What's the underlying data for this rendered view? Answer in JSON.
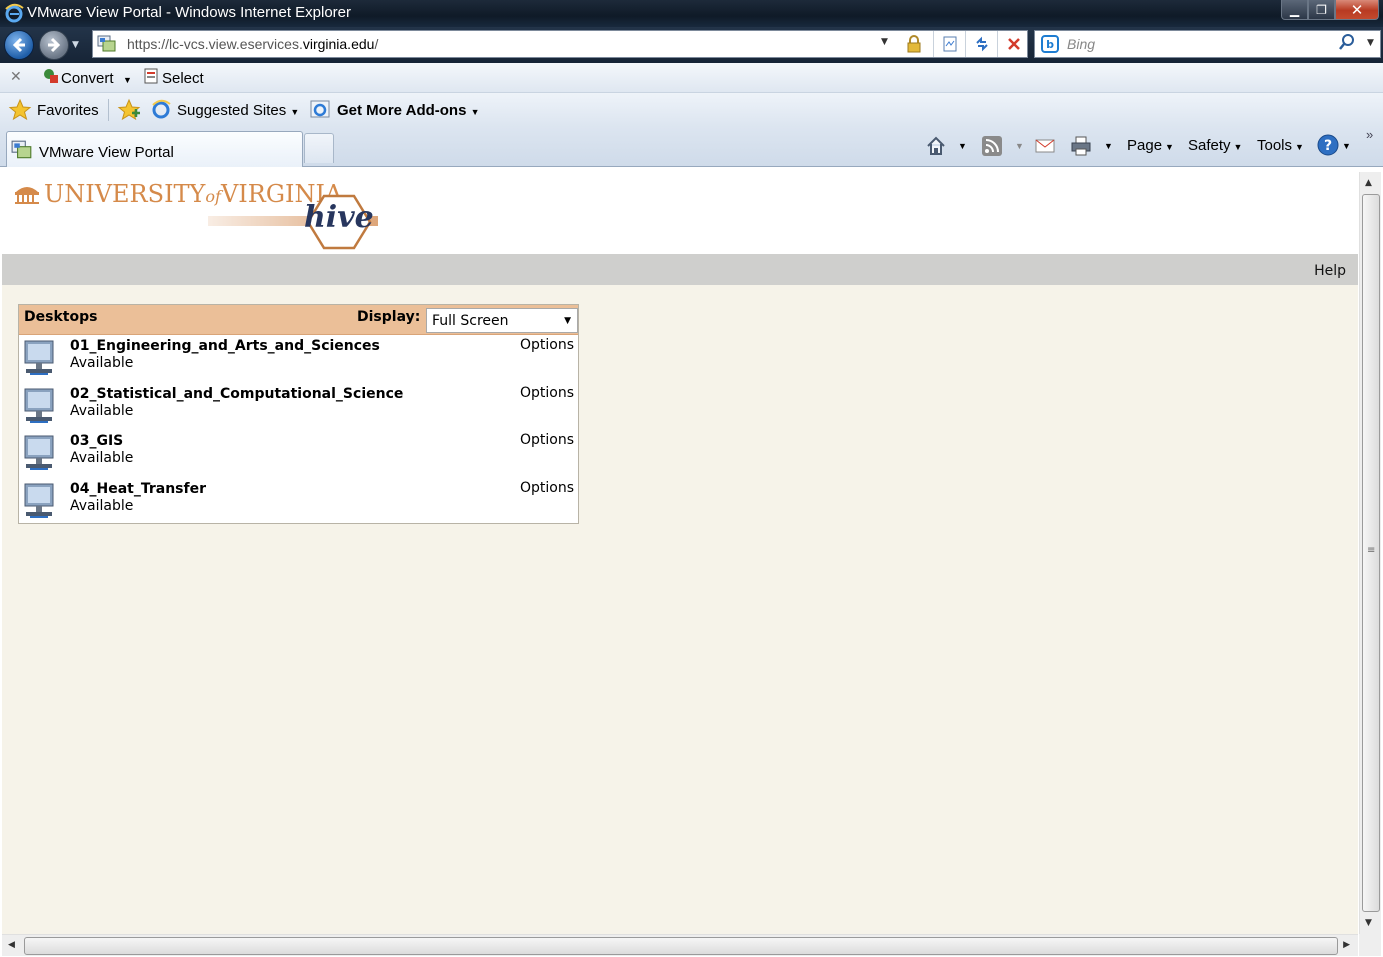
{
  "window": {
    "title": "VMware View Portal - Windows Internet Explorer",
    "min": "▁",
    "restore": "❐",
    "close": "✕"
  },
  "address": {
    "url_prefix": "https://lc-vcs.view.eservices.",
    "url_domain": "virginia.edu",
    "url_suffix": "/"
  },
  "search": {
    "placeholder": "Bing"
  },
  "toolbar": {
    "convert_label": "Convert",
    "select_label": "Select"
  },
  "favorites": {
    "favorites_label": "Favorites",
    "suggested_label": "Suggested Sites",
    "addons_label": "Get More Add-ons"
  },
  "tab": {
    "label": "VMware View Portal"
  },
  "commands": {
    "page": "Page",
    "safety": "Safety",
    "tools": "Tools"
  },
  "portal": {
    "logo_university": "UNIVERSITY",
    "logo_of": "of",
    "logo_virginia": "VIRGINIA",
    "logo_hive": "hive",
    "help": "Help",
    "desktops_title": "Desktops",
    "display_label": "Display:",
    "display_value": "Full Screen",
    "desktops": [
      {
        "name": "01_Engineering_and_Arts_and_Sciences",
        "status": "Available",
        "options": "Options"
      },
      {
        "name": "02_Statistical_and_Computational_Science",
        "status": "Available",
        "options": "Options"
      },
      {
        "name": "03_GIS",
        "status": "Available",
        "options": "Options"
      },
      {
        "name": "04_Heat_Transfer",
        "status": "Available",
        "options": "Options"
      }
    ]
  }
}
